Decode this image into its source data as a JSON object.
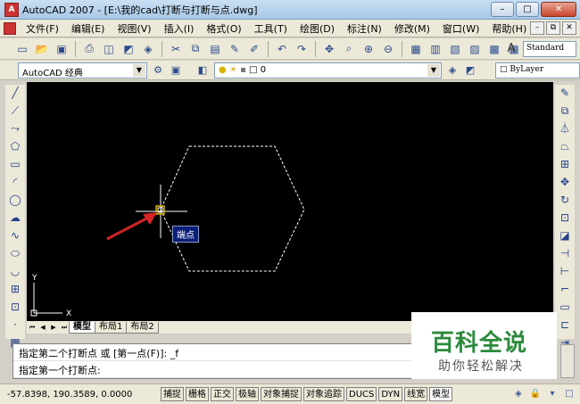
{
  "window": {
    "title": "AutoCAD 2007 - [E:\\我的cad\\打断与打断与点.dwg]",
    "minimize": "–",
    "maximize": "□",
    "close": "✕"
  },
  "menu": {
    "items": [
      "文件(F)",
      "编辑(E)",
      "视图(V)",
      "插入(I)",
      "格式(O)",
      "工具(T)",
      "绘图(D)",
      "标注(N)",
      "修改(M)",
      "窗口(W)",
      "帮助(H)"
    ],
    "doc_min": "–",
    "doc_restore": "⧉",
    "doc_close": "✕"
  },
  "toolbar": {
    "text_style": "Standard"
  },
  "properties": {
    "workspace": "AutoCAD 经典",
    "layer": "0",
    "color": "ByLayer"
  },
  "drawing": {
    "tooltip": "端点",
    "ucs_y": "Y",
    "ucs_x": "X"
  },
  "tabs": {
    "items": [
      "模型",
      "布局1",
      "布局2"
    ]
  },
  "command": {
    "line1": "指定第二个打断点 或 [第一点(F)]: _f",
    "line2": "指定第一个打断点:"
  },
  "status": {
    "coords": "-57.8398,  190.3589, 0.0000",
    "buttons": [
      "捕捉",
      "栅格",
      "正交",
      "极轴",
      "对象捕捉",
      "对象追踪",
      "DUCS",
      "DYN",
      "线宽",
      "模型"
    ]
  },
  "watermark": {
    "main": "百科全说",
    "sub": "助你轻松解决"
  },
  "colors": {
    "canvas": "#000000",
    "hexagon": "#ffffff",
    "arrow": "#d42424",
    "tooltip_bg": "#0b1e78"
  }
}
